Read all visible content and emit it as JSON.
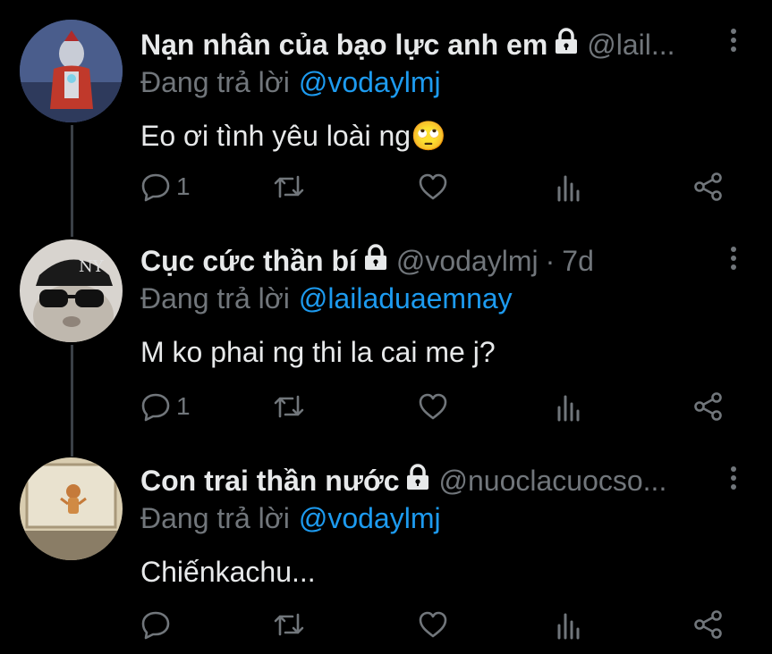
{
  "reply_prefix": "Đang trả lời",
  "tweets": [
    {
      "name": "Nạn nhân của bạo lực anh em",
      "handle": "@lail...",
      "time": "",
      "reply_to": "@vodaylmj",
      "text": "Eo ơi tình yêu loài ng",
      "emoji": "🙄",
      "reply_count": "1",
      "avatar_desc": "ultraman-figure"
    },
    {
      "name": "Cục cức thần bí",
      "handle": "@vodaylmj",
      "time": "7d",
      "reply_to": "@lailaduaemnay",
      "text": "M ko phai ng thi la cai me j?",
      "emoji": "",
      "reply_count": "1",
      "avatar_desc": "cat-with-cap-and-sunglasses"
    },
    {
      "name": "Con trai thần nước",
      "handle": "@nuoclacuocso...",
      "time": "",
      "reply_to": "@vodaylmj",
      "text": "Chiếnkachu...",
      "emoji": "",
      "reply_count": "",
      "avatar_desc": "cartoon-on-window"
    }
  ],
  "colors": {
    "background": "#000000",
    "text": "#e7e9ea",
    "muted": "#71767b",
    "link": "#1d9bf0"
  },
  "icons": [
    "lock-icon",
    "reply-icon",
    "retweet-icon",
    "like-icon",
    "analytics-icon",
    "share-icon",
    "more-icon"
  ]
}
